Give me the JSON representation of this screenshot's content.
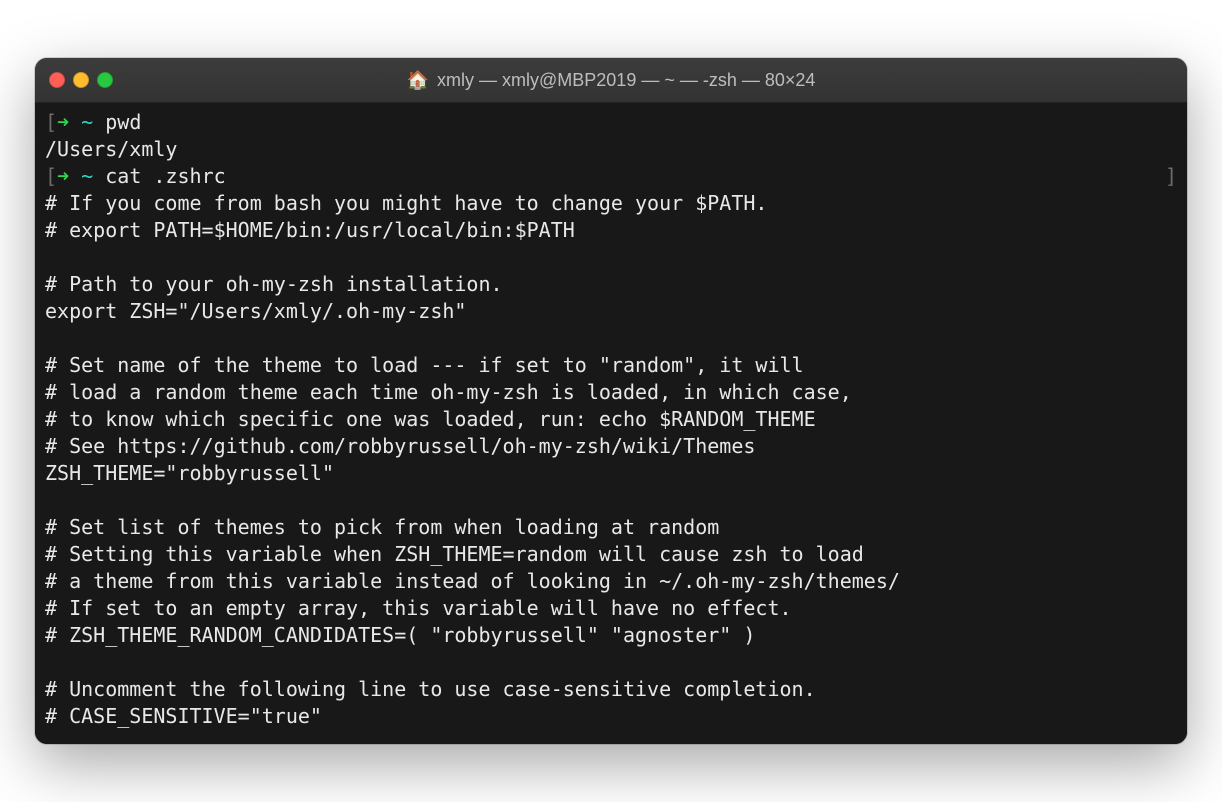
{
  "window": {
    "title_icon": "🏠",
    "title": "xmly — xmly@MBP2019 — ~ — -zsh — 80×24"
  },
  "prompt": {
    "open_bracket": "[",
    "arrow": "➜",
    "tilde": "~",
    "close_bracket": "]"
  },
  "session": {
    "cmd1": "pwd",
    "out1": "/Users/xmly",
    "cmd2": "cat .zshrc",
    "lines": [
      "# If you come from bash you might have to change your $PATH.",
      "# export PATH=$HOME/bin:/usr/local/bin:$PATH",
      "",
      "# Path to your oh-my-zsh installation.",
      "export ZSH=\"/Users/xmly/.oh-my-zsh\"",
      "",
      "# Set name of the theme to load --- if set to \"random\", it will",
      "# load a random theme each time oh-my-zsh is loaded, in which case,",
      "# to know which specific one was loaded, run: echo $RANDOM_THEME",
      "# See https://github.com/robbyrussell/oh-my-zsh/wiki/Themes",
      "ZSH_THEME=\"robbyrussell\"",
      "",
      "# Set list of themes to pick from when loading at random",
      "# Setting this variable when ZSH_THEME=random will cause zsh to load",
      "# a theme from this variable instead of looking in ~/.oh-my-zsh/themes/",
      "# If set to an empty array, this variable will have no effect.",
      "# ZSH_THEME_RANDOM_CANDIDATES=( \"robbyrussell\" \"agnoster\" )",
      "",
      "# Uncomment the following line to use case-sensitive completion.",
      "# CASE_SENSITIVE=\"true\""
    ]
  }
}
